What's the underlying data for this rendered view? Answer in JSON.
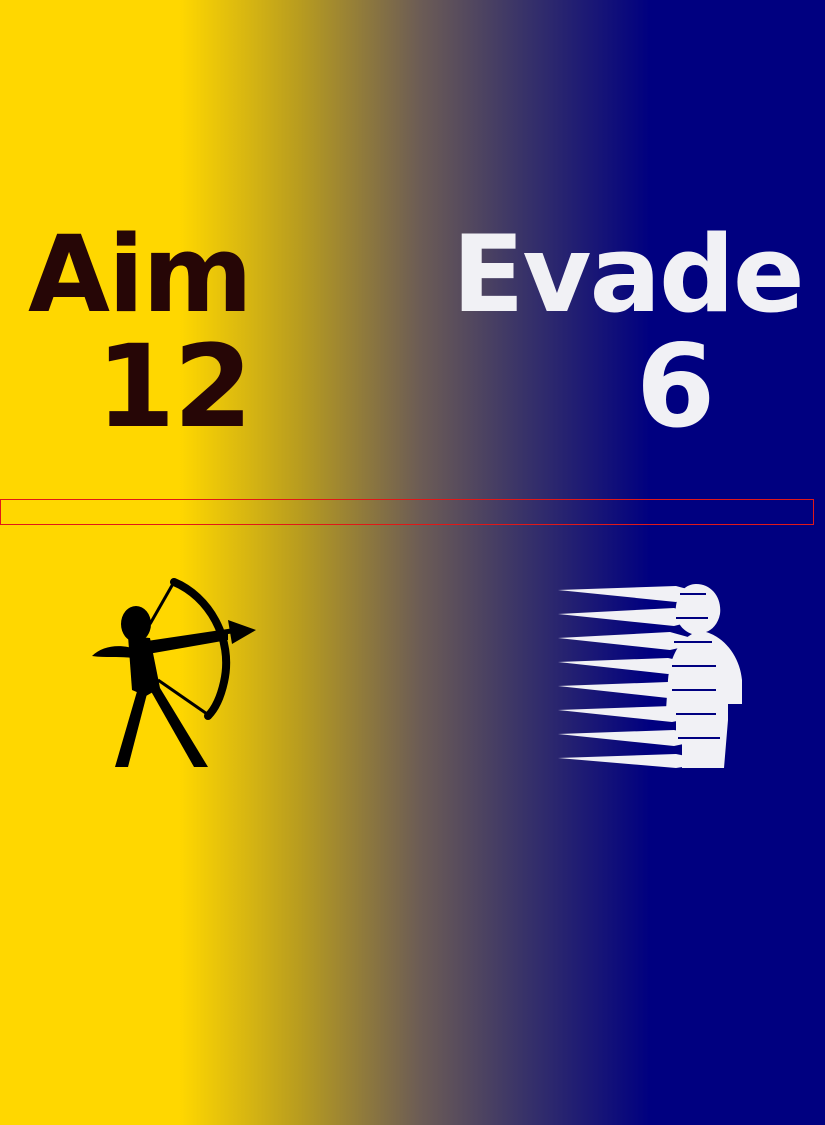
{
  "stats": {
    "aim": {
      "label": "Aim",
      "value": "12",
      "icon": "archer-icon",
      "color": "#260606"
    },
    "evade": {
      "label": "Evade",
      "value": "6",
      "icon": "evade-icon",
      "color": "#f1f1f5"
    }
  },
  "colors": {
    "left_background": "#FFD700",
    "right_background": "#000080",
    "divider_border": "#e01818"
  }
}
